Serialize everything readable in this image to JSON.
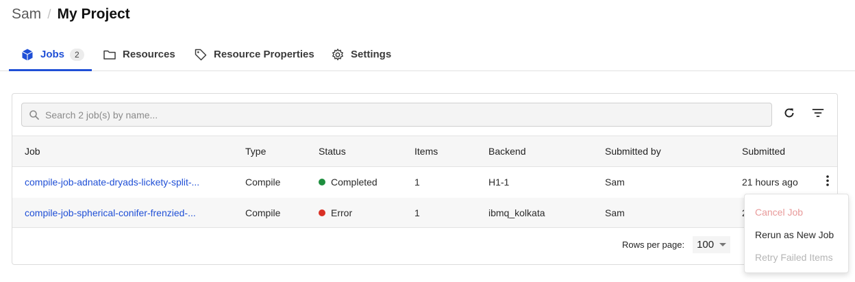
{
  "breadcrumb": {
    "user": "Sam",
    "separator": "/",
    "project": "My Project"
  },
  "tabs": [
    {
      "label": "Jobs",
      "badge": "2",
      "icon": "cube-icon",
      "active": true
    },
    {
      "label": "Resources",
      "icon": "folder-icon"
    },
    {
      "label": "Resource Properties",
      "icon": "tag-icon"
    },
    {
      "label": "Settings",
      "icon": "gear-icon"
    }
  ],
  "search": {
    "placeholder": "Search 2 job(s) by name...",
    "value": ""
  },
  "toolbar": {
    "refresh_icon": "refresh-icon",
    "filter_icon": "filter-icon"
  },
  "table": {
    "columns": [
      "Job",
      "Type",
      "Status",
      "Items",
      "Backend",
      "Submitted by",
      "Submitted"
    ],
    "rows": [
      {
        "job": "compile-job-adnate-dryads-lickety-split-...",
        "type": "Compile",
        "status": "Completed",
        "status_color": "#1e8e3e",
        "items": "1",
        "backend": "H1-1",
        "submitted_by": "Sam",
        "submitted": "21 hours ago"
      },
      {
        "job": "compile-job-spherical-conifer-frenzied-...",
        "type": "Compile",
        "status": "Error",
        "status_color": "#d93025",
        "items": "1",
        "backend": "ibmq_kolkata",
        "submitted_by": "Sam",
        "submitted": "2"
      }
    ]
  },
  "pagination": {
    "label": "Rows per page:",
    "value": "100"
  },
  "context_menu": {
    "items": [
      {
        "label": "Cancel Job",
        "state": "disabled-danger"
      },
      {
        "label": "Rerun as New Job",
        "state": "enabled"
      },
      {
        "label": "Retry Failed Items",
        "state": "disabled"
      }
    ]
  },
  "colors": {
    "accent": "#1f4fd6",
    "completed": "#1e8e3e",
    "error": "#d93025"
  }
}
